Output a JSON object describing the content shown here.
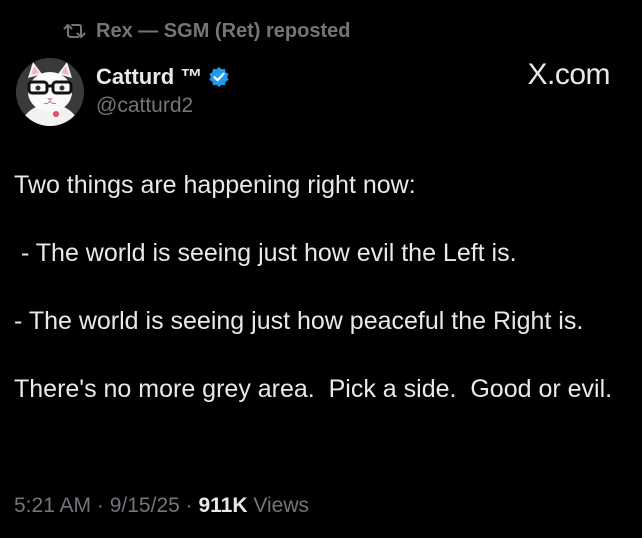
{
  "repost": {
    "icon": "repost-icon",
    "text": "Rex — SGM (Ret) reposted"
  },
  "author": {
    "display_name": "Catturd ™",
    "handle": "@catturd2",
    "verified": true,
    "verified_color": "#1d9bf0",
    "avatar": "avatar"
  },
  "source_label": "X.com",
  "post": {
    "line1": "Two things are happening right now:",
    "line2": " - The world is seeing just how evil the Left is.",
    "line3": "- The world is seeing just how peaceful the Right is.",
    "line4": "There's no more grey area.  Pick a side.  Good or evil."
  },
  "meta": {
    "time": "5:21 AM",
    "separator1": " · ",
    "date": "9/15/25",
    "separator2": " · ",
    "views_count": "911K",
    "views_label": " Views"
  },
  "colors": {
    "background": "#000000",
    "text_primary": "#e7e9ea",
    "text_secondary": "#71767b"
  }
}
